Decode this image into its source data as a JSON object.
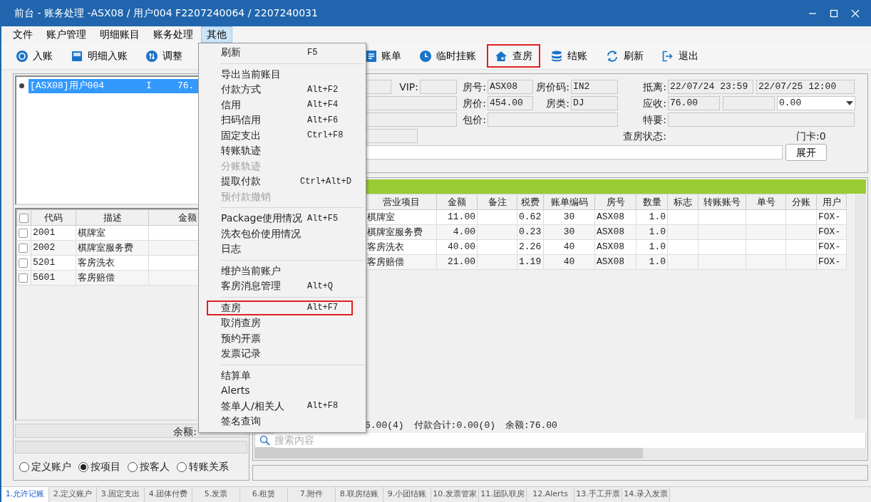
{
  "window": {
    "title": "前台 - 账务处理 -ASX08 / 用户004 F2207240064 / 2207240031"
  },
  "menu_bar": [
    {
      "label": "文件",
      "selected": false
    },
    {
      "label": "账户管理",
      "selected": false
    },
    {
      "label": "明细账目",
      "selected": false
    },
    {
      "label": "账务处理",
      "selected": false
    },
    {
      "label": "其他",
      "selected": true
    }
  ],
  "toolbar_left": [
    {
      "label": "入账",
      "kind": "coin",
      "marked": false
    },
    {
      "label": "明细入账",
      "kind": "tray",
      "marked": false
    },
    {
      "label": "调整",
      "kind": "adjust",
      "marked": false
    }
  ],
  "toolbar_right": [
    {
      "label": "账单",
      "kind": "document",
      "marked": false
    },
    {
      "label": "临时挂账",
      "kind": "clock",
      "marked": false
    },
    {
      "label": "查房",
      "kind": "house",
      "marked": true
    },
    {
      "label": "结账",
      "kind": "database",
      "marked": false
    },
    {
      "label": "刷新",
      "kind": "refresh",
      "marked": false
    },
    {
      "label": "退出",
      "kind": "exit",
      "marked": false
    }
  ],
  "accounts": [
    {
      "room": "[ASX08]用户004",
      "status": "I",
      "balance": "76.",
      "selected": true
    }
  ],
  "items": {
    "select_all_checked": false,
    "columns": [
      "代码",
      "描述",
      "金额"
    ],
    "rows": [
      {
        "code": "2001",
        "description": "棋牌室",
        "checked": false
      },
      {
        "code": "2002",
        "description": "棋牌室服务费",
        "checked": false
      },
      {
        "code": "5201",
        "description": "客房洗衣",
        "checked": false
      },
      {
        "code": "5601",
        "description": "客房赔偿",
        "checked": false
      }
    ],
    "balance_label": "余额:"
  },
  "view_options": [
    {
      "label": "定义账户",
      "selected": false
    },
    {
      "label": "按项目",
      "selected": true
    },
    {
      "label": "按客人",
      "selected": false
    },
    {
      "label": "转账关系",
      "selected": false
    }
  ],
  "info": {
    "vip_label": "VIP:",
    "room_label": "房号:",
    "room": "ASX08",
    "rate_code_label": "房价码:",
    "rate_code": "IN2",
    "stay_label": "抵离:",
    "arrival": "22/07/24 23:59",
    "departure": "22/07/25 12:00",
    "rate_label": "房价:",
    "rate": "454.00",
    "room_type_label": "房类:",
    "room_type": "DJ",
    "receivable_label": "应收:",
    "receivable": "76.00",
    "dropdown_value": "0.00",
    "package_label": "包价:",
    "special_label": "特要:",
    "inspection_label": "查房状态:",
    "door_card": "门卡:0",
    "expand_button": "展开"
  },
  "charges": {
    "columns": [
      "营业项目",
      "金额",
      "备注",
      "税费",
      "账单编码",
      "房号",
      "数量",
      "标志",
      "转账账号",
      "单号",
      "分账",
      "用户"
    ],
    "rows": [
      {
        "item": "棋牌室",
        "amount": "11.00",
        "tax": "0.62",
        "bill_code": "30",
        "room": "ASX08",
        "qty": "1.0",
        "user": "FOX-"
      },
      {
        "item": "棋牌室服务费",
        "amount": "4.00",
        "tax": "0.23",
        "bill_code": "30",
        "room": "ASX08",
        "qty": "1.0",
        "user": "FOX-"
      },
      {
        "item": "客房洗衣",
        "amount": "40.00",
        "tax": "2.26",
        "bill_code": "40",
        "room": "ASX08",
        "qty": "1.0",
        "user": "FOX-"
      },
      {
        "item": "客房赔偿",
        "amount": "21.00",
        "tax": "1.19",
        "bill_code": "40",
        "room": "ASX08",
        "qty": "1.0",
        "user": "FOX-"
      }
    ],
    "summary": [
      "6.00(4)",
      "付款合计:0.00(0)",
      "余额:76.00"
    ]
  },
  "search": {
    "placeholder": "搜索内容"
  },
  "context_menu": {
    "groups": [
      [
        {
          "label": "刷新",
          "shortcut": "F5",
          "disabled": false,
          "marked": false
        }
      ],
      [
        {
          "label": "导出当前账目",
          "disabled": false,
          "marked": false
        },
        {
          "label": "付款方式",
          "shortcut": "Alt+F2",
          "disabled": false,
          "marked": false
        },
        {
          "label": "信用",
          "shortcut": "Alt+F4",
          "disabled": false,
          "marked": false
        },
        {
          "label": "扫码信用",
          "shortcut": "Alt+F6",
          "disabled": false,
          "marked": false
        },
        {
          "label": "固定支出",
          "shortcut": "Ctrl+F8",
          "disabled": false,
          "marked": false
        },
        {
          "label": "转账轨迹",
          "disabled": false,
          "marked": false
        },
        {
          "label": "分账轨迹",
          "disabled": true,
          "marked": false
        },
        {
          "label": "提取付款",
          "shortcut": "Ctrl+Alt+D",
          "disabled": false,
          "marked": false
        },
        {
          "label": "预付款撤销",
          "disabled": true,
          "marked": false
        }
      ],
      [
        {
          "label": "Package使用情况",
          "shortcut": "Alt+F5",
          "disabled": false,
          "marked": false
        },
        {
          "label": "洗衣包价使用情况",
          "disabled": false,
          "marked": false
        },
        {
          "label": "日志",
          "disabled": false,
          "marked": false
        }
      ],
      [
        {
          "label": "维护当前账户",
          "disabled": false,
          "marked": false
        },
        {
          "label": "客房消息管理",
          "shortcut": "Alt+Q",
          "disabled": false,
          "marked": false
        }
      ],
      [
        {
          "label": "查房",
          "shortcut": "Alt+F7",
          "disabled": false,
          "marked": true
        },
        {
          "label": "取消查房",
          "disabled": false,
          "marked": false
        },
        {
          "label": "预约开票",
          "disabled": false,
          "marked": false
        },
        {
          "label": "发票记录",
          "disabled": false,
          "marked": false
        }
      ],
      [
        {
          "label": "结算单",
          "disabled": false,
          "marked": false
        },
        {
          "label": "Alerts",
          "disabled": false,
          "marked": false
        },
        {
          "label": "签单人/相关人",
          "shortcut": "Alt+F8",
          "disabled": false,
          "marked": false
        },
        {
          "label": "签名查询",
          "disabled": false,
          "marked": false
        }
      ]
    ]
  },
  "bottom_tabs": [
    {
      "label": "1.允许记账",
      "selected": true
    },
    {
      "label": "2.定义账户",
      "selected": false
    },
    {
      "label": "3.固定支出",
      "selected": false
    },
    {
      "label": "4.团体付费",
      "selected": false
    },
    {
      "label": "5.发票",
      "selected": false
    },
    {
      "label": "6.租赁",
      "selected": false
    },
    {
      "label": "7.附件",
      "selected": false
    },
    {
      "label": "8.联房结账",
      "selected": false
    },
    {
      "label": "9.小团结账",
      "selected": false
    },
    {
      "label": "10.发票管家",
      "selected": false
    },
    {
      "label": "11.团队联房",
      "selected": false
    },
    {
      "label": "12.Alerts",
      "selected": false
    },
    {
      "label": "13.手工开票",
      "selected": false
    },
    {
      "label": "14.录入发票",
      "selected": false
    }
  ]
}
